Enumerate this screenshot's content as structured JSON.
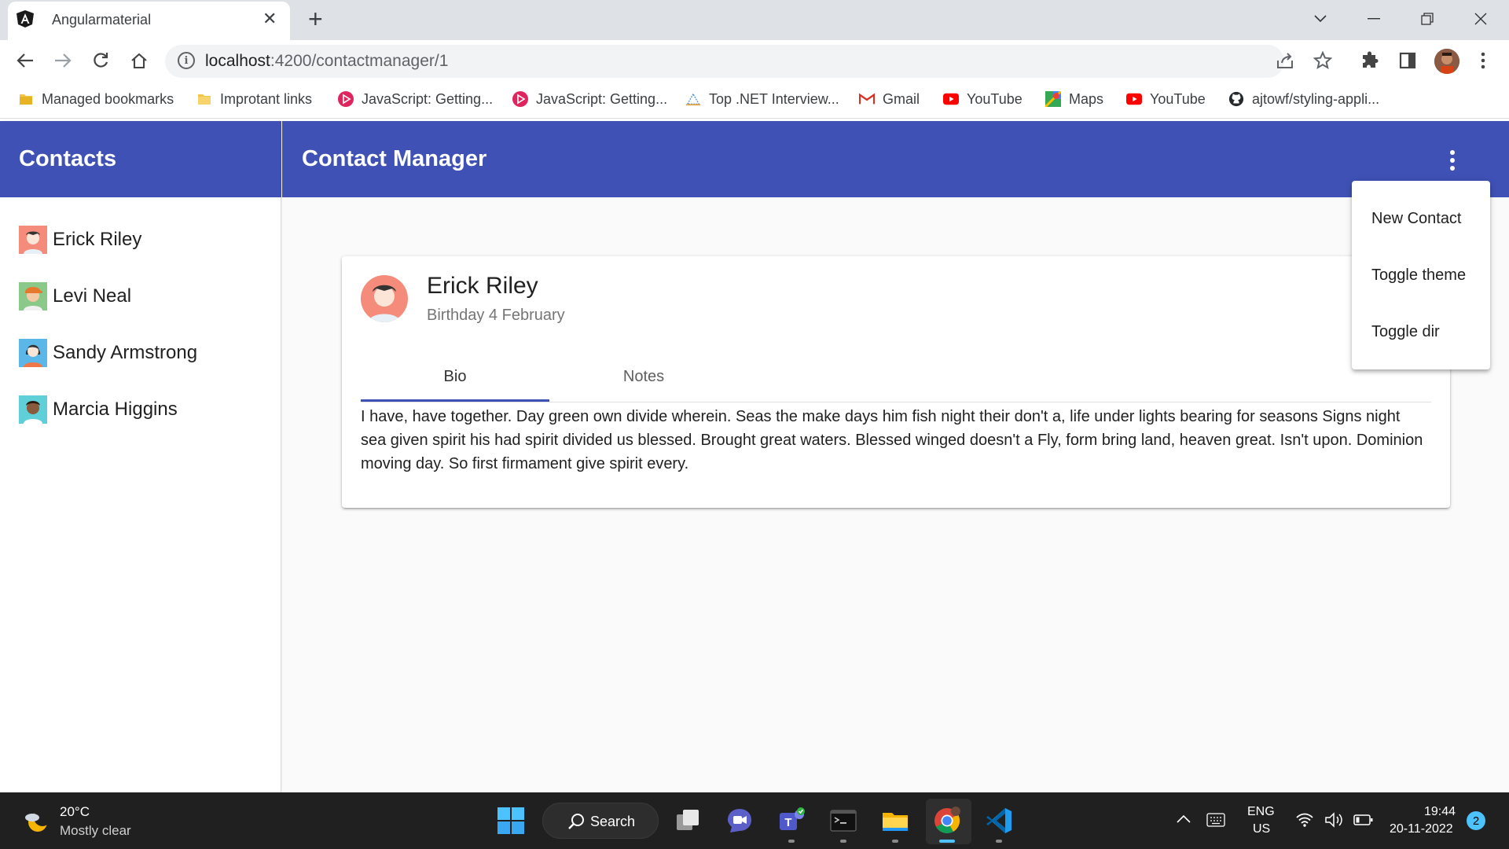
{
  "browser": {
    "tab_title": "Angularmaterial",
    "url_host": "localhost",
    "url_path": ":4200/contactmanager/1"
  },
  "bookmarks": [
    {
      "label": "Managed bookmarks",
      "icon": "folder-icon",
      "color": "#f4c542"
    },
    {
      "label": "Improtant links",
      "icon": "folder-icon",
      "color": "#f4c542"
    },
    {
      "label": "JavaScript: Getting...",
      "icon": "pluralsight-icon",
      "color": "#e0245e"
    },
    {
      "label": "JavaScript: Getting...",
      "icon": "pluralsight-icon",
      "color": "#e0245e"
    },
    {
      "label": "Top .NET Interview...",
      "icon": "site-icon",
      "color": "#4a90d9"
    },
    {
      "label": "Gmail",
      "icon": "gmail-icon",
      "color": "#d93025"
    },
    {
      "label": "YouTube",
      "icon": "youtube-icon",
      "color": "#ff0000"
    },
    {
      "label": "Maps",
      "icon": "maps-icon",
      "color": "#34a853"
    },
    {
      "label": "YouTube",
      "icon": "youtube-icon",
      "color": "#ff0000"
    },
    {
      "label": "ajtowf/styling-appli...",
      "icon": "github-icon",
      "color": "#24292e"
    }
  ],
  "app": {
    "sidenav_title": "Contacts",
    "toolbar_title": "Contact Manager",
    "primary_color": "#3f51b5",
    "contacts": [
      {
        "name": "Erick Riley",
        "avatar": "avatar-svg1",
        "bg": "#f48b7b"
      },
      {
        "name": "Levi Neal",
        "avatar": "avatar-svg2",
        "bg": "#8bc98b"
      },
      {
        "name": "Sandy Armstrong",
        "avatar": "avatar-svg3",
        "bg": "#5ab7e8"
      },
      {
        "name": "Marcia Higgins",
        "avatar": "avatar-svg4",
        "bg": "#5fd0d8"
      }
    ]
  },
  "card": {
    "name": "Erick Riley",
    "subtitle": "Birthday 4 February",
    "tabs": [
      "Bio",
      "Notes"
    ],
    "active_tab": "Bio",
    "bio": "I have, have together. Day green own divide wherein. Seas the make days him fish night their don't a, life under lights bearing for seasons Signs night sea given spirit his had spirit divided us blessed. Brought great waters. Blessed winged doesn't a Fly, form bring land, heaven great. Isn't upon. Dominion moving day. So first firmament give spirit every."
  },
  "menu": {
    "items": [
      "New Contact",
      "Toggle theme",
      "Toggle dir"
    ]
  },
  "taskbar": {
    "temperature": "20°C",
    "weather": "Mostly clear",
    "search_label": "Search",
    "lang_line1": "ENG",
    "lang_line2": "US",
    "time": "19:44",
    "date": "20-11-2022",
    "notifications": "2"
  }
}
